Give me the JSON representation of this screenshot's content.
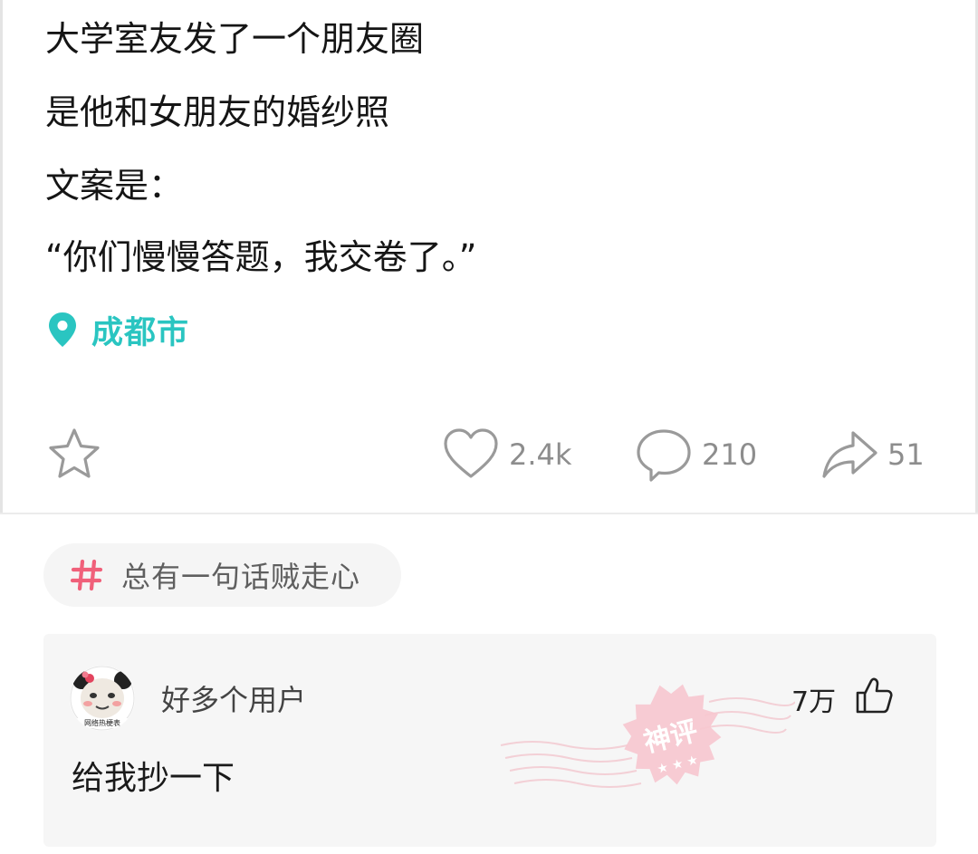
{
  "post": {
    "lines": [
      "大学室友发了一个朋友圈",
      "是他和女朋友的婚纱照",
      "文案是：",
      "“你们慢慢答题，我交卷了。”"
    ],
    "location": "成都市",
    "location_icon": "location-pin-icon",
    "accent_color": "#2ac5c1"
  },
  "actions": {
    "favorite_icon": "star-icon",
    "like": {
      "icon": "heart-icon",
      "count": "2.4k"
    },
    "comment": {
      "icon": "comment-bubble-icon",
      "count": "210"
    },
    "share": {
      "icon": "share-arrow-icon",
      "count": "51"
    }
  },
  "topic": {
    "icon": "hash-icon",
    "label": "总有一句话贼走心",
    "icon_color": "#f0607a"
  },
  "comment": {
    "username": "好多个用户",
    "avatar_caption": "网络热梗表",
    "text": "给我抄一下",
    "like_count": "7万",
    "like_icon": "thumbs-up-icon",
    "stamp_label": "神评",
    "stamp_color": "#f7c6cf"
  }
}
